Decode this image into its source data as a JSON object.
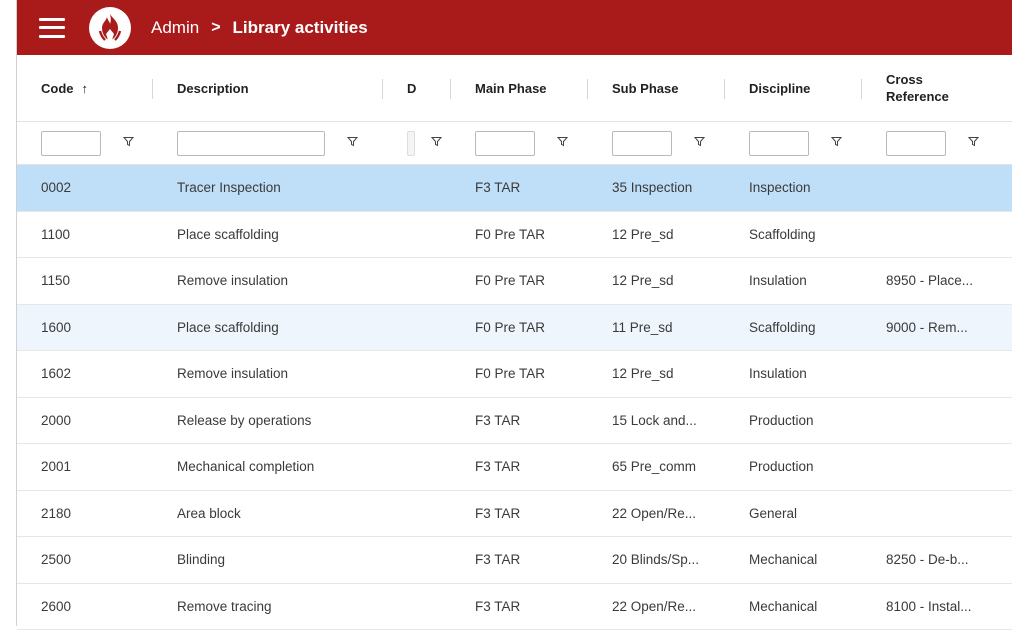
{
  "header": {
    "breadcrumb_root": "Admin",
    "breadcrumb_separator": ">",
    "breadcrumb_current": "Library activities"
  },
  "colors": {
    "topbar": "#a91b1b",
    "selected_row": "#bfdff8",
    "hover_row": "#eef5fc"
  },
  "columns": [
    {
      "label": "Code",
      "sort": "↑"
    },
    {
      "label": "Description"
    },
    {
      "label": "D"
    },
    {
      "label": "Main Phase"
    },
    {
      "label": "Sub Phase"
    },
    {
      "label": "Discipline"
    },
    {
      "label": "Cross Reference"
    }
  ],
  "filters": [
    "",
    "",
    "",
    "",
    "",
    "",
    ""
  ],
  "rows": [
    {
      "code": "0002",
      "description": "Tracer Inspection",
      "d": "",
      "main_phase": "F3 TAR",
      "sub_phase": "35 Inspection",
      "discipline": "Inspection",
      "cross_reference": "",
      "state": "selected"
    },
    {
      "code": "1100",
      "description": "Place scaffolding",
      "d": "",
      "main_phase": "F0 Pre TAR",
      "sub_phase": "12 Pre_sd",
      "discipline": "Scaffolding",
      "cross_reference": "",
      "state": ""
    },
    {
      "code": "1150",
      "description": "Remove insulation",
      "d": "",
      "main_phase": "F0 Pre TAR",
      "sub_phase": "12 Pre_sd",
      "discipline": "Insulation",
      "cross_reference": "8950 - Place...",
      "state": ""
    },
    {
      "code": "1600",
      "description": "Place scaffolding",
      "d": "",
      "main_phase": "F0 Pre TAR",
      "sub_phase": "11 Pre_sd",
      "discipline": "Scaffolding",
      "cross_reference": "9000 - Rem...",
      "state": "hover"
    },
    {
      "code": "1602",
      "description": "Remove insulation",
      "d": "",
      "main_phase": "F0 Pre TAR",
      "sub_phase": "12 Pre_sd",
      "discipline": "Insulation",
      "cross_reference": "",
      "state": ""
    },
    {
      "code": "2000",
      "description": "Release by operations",
      "d": "",
      "main_phase": "F3 TAR",
      "sub_phase": "15 Lock and...",
      "discipline": "Production",
      "cross_reference": "",
      "state": ""
    },
    {
      "code": "2001",
      "description": "Mechanical completion",
      "d": "",
      "main_phase": "F3 TAR",
      "sub_phase": "65 Pre_comm",
      "discipline": "Production",
      "cross_reference": "",
      "state": ""
    },
    {
      "code": "2180",
      "description": "Area block",
      "d": "",
      "main_phase": "F3 TAR",
      "sub_phase": "22 Open/Re...",
      "discipline": "General",
      "cross_reference": "",
      "state": ""
    },
    {
      "code": "2500",
      "description": "Blinding",
      "d": "",
      "main_phase": "F3 TAR",
      "sub_phase": "20 Blinds/Sp...",
      "discipline": "Mechanical",
      "cross_reference": "8250 - De-b...",
      "state": ""
    },
    {
      "code": "2600",
      "description": "Remove tracing",
      "d": "",
      "main_phase": "F3 TAR",
      "sub_phase": "22 Open/Re...",
      "discipline": "Mechanical",
      "cross_reference": "8100 - Instal...",
      "state": ""
    }
  ]
}
